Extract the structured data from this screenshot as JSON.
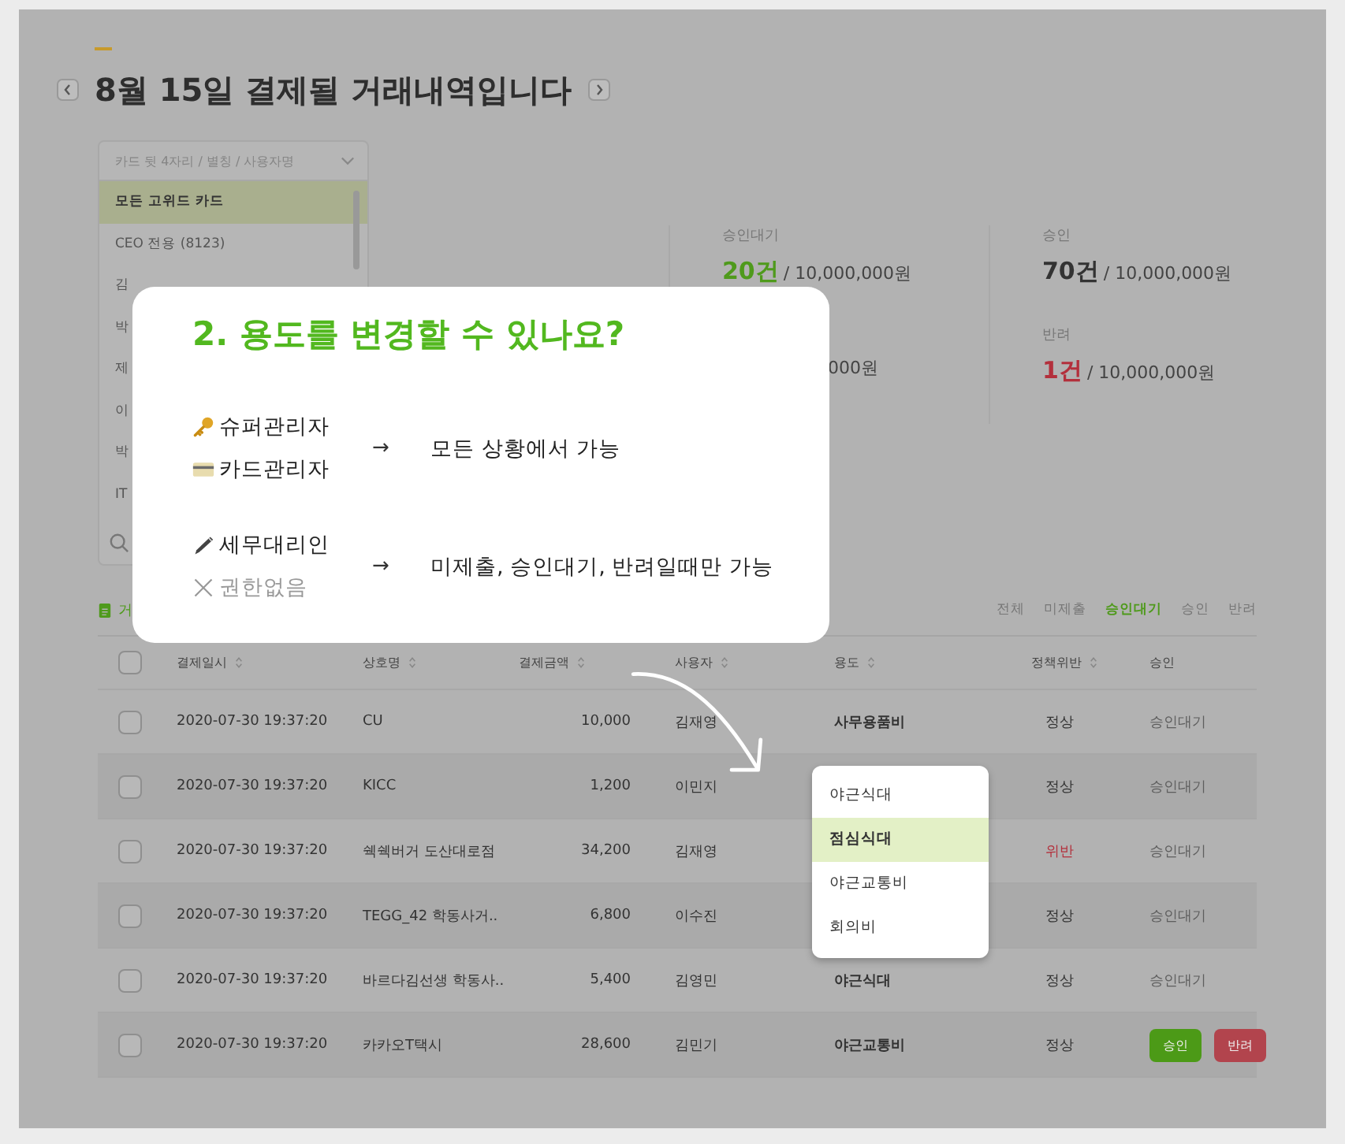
{
  "page": {
    "title": "8월 15일 결제될 거래내역입니다"
  },
  "card_filter": {
    "placeholder": "카드 뒷 4자리 / 별칭 / 사용자명",
    "items": [
      {
        "label": "모든 고위드 카드",
        "selected": true
      },
      {
        "label": "CEO 전용 (8123)",
        "selected": false
      },
      {
        "label": "김",
        "selected": false
      },
      {
        "label": "박",
        "selected": false
      },
      {
        "label": "제",
        "selected": false
      },
      {
        "label": "이",
        "selected": false
      },
      {
        "label": "박",
        "selected": false
      },
      {
        "label": "IT",
        "selected": false
      }
    ]
  },
  "stats": [
    {
      "label": "승인대기",
      "count": "20건",
      "amount": "/ 10,000,000원",
      "color": "#4f9a1c"
    },
    {
      "label": "승인",
      "count": "70건",
      "amount": "/ 10,000,000원",
      "color": "#333333"
    },
    {
      "amount": "000원"
    },
    {
      "label": "반려",
      "count": "1건",
      "amount": "/ 10,000,000원",
      "color": "#b3303c"
    }
  ],
  "section_label": "거",
  "filters": [
    {
      "label": "전체",
      "selected": false
    },
    {
      "label": "미제출",
      "selected": false
    },
    {
      "label": "승인대기",
      "selected": true
    },
    {
      "label": "승인",
      "selected": false
    },
    {
      "label": "반려",
      "selected": false
    }
  ],
  "table": {
    "header_checked": false,
    "columns": [
      {
        "label": "결제일시",
        "sortable": true
      },
      {
        "label": "상호명",
        "sortable": true
      },
      {
        "label": "결제금액",
        "sortable": true
      },
      {
        "label": "사용자",
        "sortable": true
      },
      {
        "label": "용도",
        "sortable": true
      },
      {
        "label": "정책위반",
        "sortable": true
      },
      {
        "label": "승인",
        "sortable": false
      }
    ],
    "rows": [
      {
        "checked": false,
        "date": "2020-07-30 19:37:20",
        "merchant": "CU",
        "amount": "10,000",
        "user": "김재영",
        "purpose": "사무용품비",
        "policy": "정상",
        "violation": false,
        "approval": {
          "kind": "status",
          "text": "승인대기"
        }
      },
      {
        "checked": false,
        "date": "2020-07-30 19:37:20",
        "merchant": "KICC",
        "amount": "1,200",
        "user": "이민지",
        "policy": "정상",
        "violation": false,
        "approval": {
          "kind": "status",
          "text": "승인대기"
        }
      },
      {
        "checked": false,
        "date": "2020-07-30 19:37:20",
        "merchant": "쉑쉑버거 도산대로점",
        "amount": "34,200",
        "user": "김재영",
        "policy": "위반",
        "violation": true,
        "approval": {
          "kind": "status",
          "text": "승인대기"
        }
      },
      {
        "checked": false,
        "date": "2020-07-30 19:37:20",
        "merchant": "TEGG_42 학동사거..",
        "amount": "6,800",
        "user": "이수진",
        "policy": "정상",
        "violation": false,
        "approval": {
          "kind": "status",
          "text": "승인대기"
        }
      },
      {
        "checked": false,
        "date": "2020-07-30 19:37:20",
        "merchant": "바르다김선생 학동사..",
        "amount": "5,400",
        "user": "김영민",
        "purpose": "야근식대",
        "policy": "정상",
        "violation": false,
        "approval": {
          "kind": "status",
          "text": "승인대기"
        }
      },
      {
        "checked": false,
        "date": "2020-07-30 19:37:20",
        "merchant": "카카오T택시",
        "amount": "28,600",
        "user": "김민기",
        "purpose": "야근교통비",
        "policy": "정상",
        "violation": false,
        "approval": {
          "kind": "buttons",
          "approve": "승인",
          "reject": "반려"
        }
      }
    ]
  },
  "purpose_menu": {
    "items": [
      {
        "label": "야근식대",
        "selected": false
      },
      {
        "label": "점심식대",
        "selected": true
      },
      {
        "label": "야근교통비",
        "selected": false
      },
      {
        "label": "회의비",
        "selected": false
      }
    ]
  },
  "tooltip": {
    "title": "2. 용도를 변경할 수 있나요?",
    "groups": [
      {
        "roles": [
          {
            "kind": "key",
            "label": "슈퍼관리자",
            "disabled": false
          },
          {
            "kind": "card",
            "label": "카드관리자",
            "disabled": false
          }
        ],
        "arrow": "→",
        "result": "모든 상황에서 가능"
      },
      {
        "roles": [
          {
            "kind": "pen",
            "label": "세무대리인",
            "disabled": false
          },
          {
            "kind": "cross",
            "label": "권한없음",
            "disabled": true
          }
        ],
        "arrow": "→",
        "result": "미제출, 승인대기, 반려일때만 가능"
      }
    ]
  }
}
